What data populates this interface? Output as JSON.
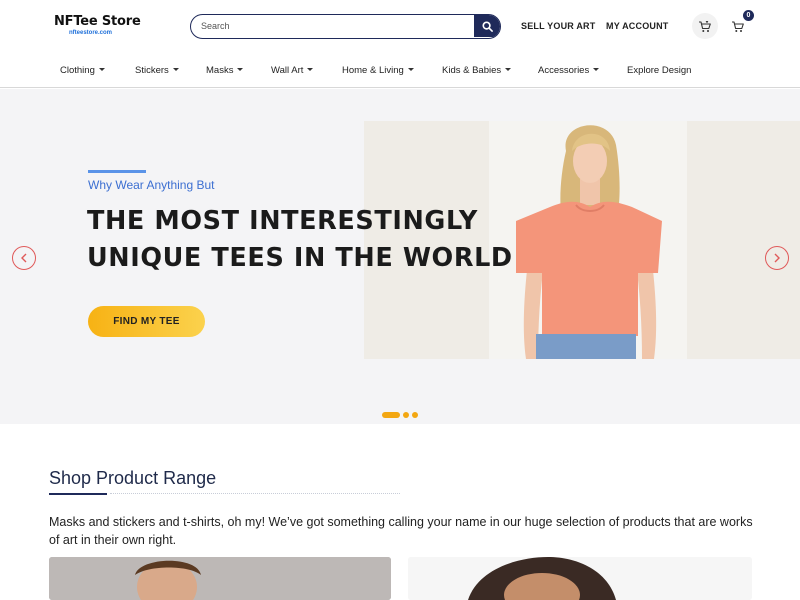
{
  "header": {
    "logo_text": "NFTee Store",
    "logo_sub": "nfteestore.com",
    "search_placeholder": "Search",
    "sell_label": "SELL YOUR ART",
    "account_label": "MY ACCOUNT",
    "cart_count": "0"
  },
  "nav": {
    "items": [
      {
        "label": "Clothing"
      },
      {
        "label": "Stickers"
      },
      {
        "label": "Masks"
      },
      {
        "label": "Wall Art"
      },
      {
        "label": "Home & Living"
      },
      {
        "label": "Kids & Babies"
      },
      {
        "label": "Accessories"
      },
      {
        "label": "Explore Design"
      }
    ]
  },
  "hero": {
    "kicker": "Why Wear Anything But",
    "headline_line1": "THE MOST INTERESTINGLY",
    "headline_line2": "UNIQUE TEES IN THE WORLD",
    "cta_label": "FIND MY TEE",
    "accent_color": "#f7b214"
  },
  "product_range": {
    "title": "Shop Product Range",
    "description": "Masks and stickers and t-shirts, oh my! We’ve got something calling your name in our huge selection of products that are works of art in their own right."
  },
  "colors": {
    "navy": "#1f2a5a",
    "accent_blue": "#3c6fd1",
    "cta_yellow": "#f7b214",
    "arrow_red": "#e05a5a"
  }
}
